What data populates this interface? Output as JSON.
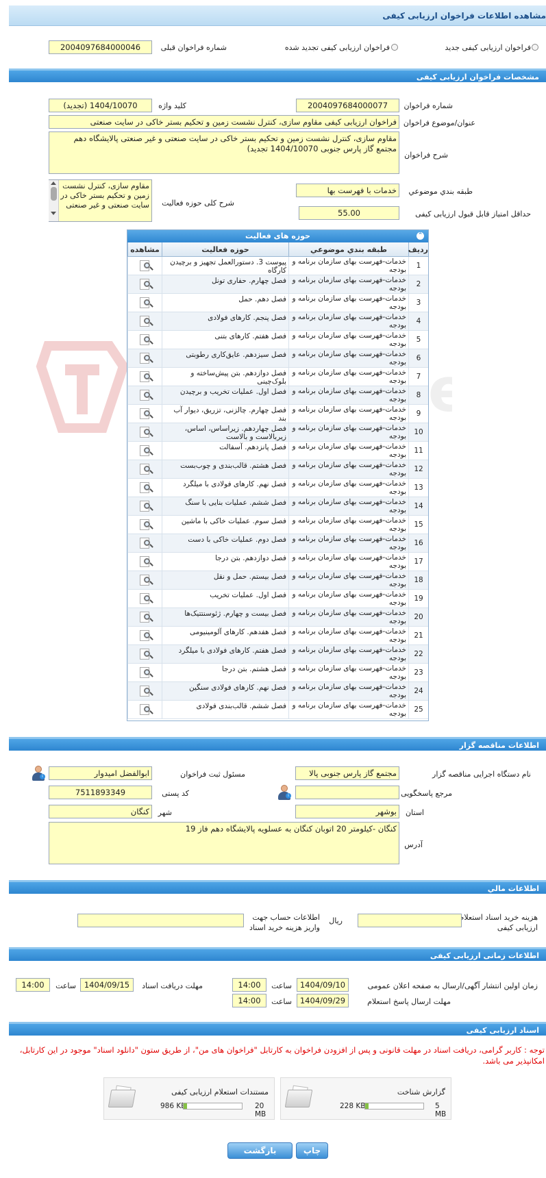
{
  "header": {
    "title": "مشاهده اطلاعات فراخوان ارزیابی کیفی"
  },
  "top": {
    "radio_new": "فراخوان ارزیابی کیفی جدید",
    "radio_renewed": "فراخوان ارزیابی کیفی تجدید شده",
    "prev_label": "شماره فراخوان قبلی",
    "prev_value": "2004097684000046"
  },
  "specs": {
    "section_title": "مشخصات فراخوان ارزیابی کیفی",
    "number_label": "شماره فراخوان",
    "number_value": "2004097684000077",
    "keyword_label": "کلید واژه",
    "keyword_value": "1404/10070 (تجدید)",
    "subject_label": "عنوان/موضوع فراخوان",
    "subject_value": "فراخوان ارزیابی کیفی مقاوم سازی، کنترل نشست زمین و تحکیم بستر خاکی در سایت صنعتی",
    "desc_label": "شرح فراخوان",
    "desc_value": "مقاوم سازی، کنترل نشست زمین و تحکیم بستر خاکی در سایت صنعتی و غیر صنعتی پالایشگاه دهم مجتمع گاز پارس جنوبی 1404/10070 تجدید)",
    "category_label": "طبقه بندي موضوعي",
    "category_value": "خدمات با فهرست بها",
    "scope_label": "شرح کلی حوزه فعالیت",
    "scope_value": "مقاوم سازی، کنترل نشست زمین و تحکیم بستر خاکی در سایت صنعتی و غیر صنعتی",
    "minscore_label": "حداقل امتیاز قابل قبول ارزیابی کیفی",
    "minscore_value": "55.00"
  },
  "activity": {
    "title": "حوزه های فعالیت",
    "headers": {
      "row": "رديف",
      "category": "طبقه بندي موضوعي",
      "field": "حوزه فعالیت",
      "view": "مشاهده"
    },
    "rows": [
      {
        "n": "1",
        "cat": "خدمات-فهرست بهای سازمان برنامه و بودجه",
        "field": "پیوست 3. دستورالعمل تجهیز و برچیدن کارگاه"
      },
      {
        "n": "2",
        "cat": "خدمات-فهرست بهای سازمان برنامه و بودجه",
        "field": "فصل چهارم. حفاری تونل"
      },
      {
        "n": "3",
        "cat": "خدمات-فهرست بهای سازمان برنامه و بودجه",
        "field": "فصل دهم. حمل"
      },
      {
        "n": "4",
        "cat": "خدمات-فهرست بهای سازمان برنامه و بودجه",
        "field": "فصل پنجم. کارهای فولادی"
      },
      {
        "n": "5",
        "cat": "خدمات-فهرست بهای سازمان برنامه و بودجه",
        "field": "فصل هفتم. کارهای بتنی"
      },
      {
        "n": "6",
        "cat": "خدمات-فهرست بهای سازمان برنامه و بودجه",
        "field": "فصل سیزدهم. عایق‌کاری رطوبتی"
      },
      {
        "n": "7",
        "cat": "خدمات-فهرست بهای سازمان برنامه و بودجه",
        "field": "فصل دوازدهم. بتن پیش‌ساخته و بلوک‌چینی"
      },
      {
        "n": "8",
        "cat": "خدمات-فهرست بهای سازمان برنامه و بودجه",
        "field": "فصل اول. عملیات تخریب و برچیدن"
      },
      {
        "n": "9",
        "cat": "خدمات-فهرست بهای سازمان برنامه و بودجه",
        "field": "فصل چهارم. چالزنی، تزریق، دیوار آب بند"
      },
      {
        "n": "10",
        "cat": "خدمات-فهرست بهای سازمان برنامه و بودجه",
        "field": "فصل چهاردهم. زیراساس، اساس، زیربالاست و بالاست"
      },
      {
        "n": "11",
        "cat": "خدمات-فهرست بهای سازمان برنامه و بودجه",
        "field": "فصل پانزدهم. آسفالت"
      },
      {
        "n": "12",
        "cat": "خدمات-فهرست بهای سازمان برنامه و بودجه",
        "field": "فصل هشتم. قالب‌بندی و چوب‌بست"
      },
      {
        "n": "13",
        "cat": "خدمات-فهرست بهای سازمان برنامه و بودجه",
        "field": "فصل نهم. کارهای فولادی با میلگرد"
      },
      {
        "n": "14",
        "cat": "خدمات-فهرست بهای سازمان برنامه و بودجه",
        "field": "فصل ششم. عملیات بنایی با سنگ"
      },
      {
        "n": "15",
        "cat": "خدمات-فهرست بهای سازمان برنامه و بودجه",
        "field": "فصل سوم. عملیات خاکی با ماشین"
      },
      {
        "n": "16",
        "cat": "خدمات-فهرست بهای سازمان برنامه و بودجه",
        "field": "فصل دوم. عملیات خاکی با دست"
      },
      {
        "n": "17",
        "cat": "خدمات-فهرست بهای سازمان برنامه و بودجه",
        "field": "فصل دوازدهم. بتن درجا"
      },
      {
        "n": "18",
        "cat": "خدمات-فهرست بهای سازمان برنامه و بودجه",
        "field": "فصل بیستم. حمل و نقل"
      },
      {
        "n": "19",
        "cat": "خدمات-فهرست بهای سازمان برنامه و بودجه",
        "field": "فصل اول. عملیات تخریب"
      },
      {
        "n": "20",
        "cat": "خدمات-فهرست بهای سازمان برنامه و بودجه",
        "field": "فصل بیست و چهارم. ژئوسنتتیک‌ها"
      },
      {
        "n": "21",
        "cat": "خدمات-فهرست بهای سازمان برنامه و بودجه",
        "field": "فصل هفدهم. کارهای آلومینیومی"
      },
      {
        "n": "22",
        "cat": "خدمات-فهرست بهای سازمان برنامه و بودجه",
        "field": "فصل هفتم. کارهای فولادی با میلگرد"
      },
      {
        "n": "23",
        "cat": "خدمات-فهرست بهای سازمان برنامه و بودجه",
        "field": "فصل هشتم. بتن درجا"
      },
      {
        "n": "24",
        "cat": "خدمات-فهرست بهای سازمان برنامه و بودجه",
        "field": "فصل نهم. کارهای فولادی سنگین"
      },
      {
        "n": "25",
        "cat": "خدمات-فهرست بهای سازمان برنامه و بودجه",
        "field": "فصل ششم. قالب‌بندی فولادی"
      }
    ]
  },
  "tenderer": {
    "section_title": "اطلاعات مناقصه گزار",
    "org_label": "نام دستگاه اجرایی مناقصه گزار",
    "org_value": "مجتمع گاز پارس جنوبی  پالا",
    "reg_label": "مسئول ثبت فراخوان",
    "reg_value": "ابوالفضل امیدوار",
    "ref_label": "مرجع پاسخگویی",
    "ref_value": "",
    "postal_label": "کد پستی",
    "postal_value": "7511893349",
    "province_label": "استان",
    "province_value": "بوشهر",
    "city_label": "شهر",
    "city_value": "کنگان",
    "address_label": "آدرس",
    "address_value": "کنگان -کیلومتر 20 اتوبان کنگان به عسلویه پالایشگاه دهم فاز 19"
  },
  "finance": {
    "section_title": "اطلاعات مالي",
    "fee_label": "هزینه خرید اسناد استعلام ارزیابی کیفی",
    "fee_unit": "ریال",
    "fee_value": "",
    "account_label": "اطلاعات حساب جهت واریز هزینه خرید اسناد",
    "account_value": ""
  },
  "timing": {
    "section_title": "اطلاعات زمانی ارزیابی کیفی",
    "publish_label": "زمان اولین انتشار آگهی/ارسال به صفحه اعلان عمومی",
    "publish_date": "1404/09/10",
    "publish_time": "14:00",
    "receive_label": "مهلت دریافت اسناد",
    "receive_date": "1404/09/15",
    "receive_time": "14:00",
    "reply_label": "مهلت ارسال پاسخ استعلام",
    "reply_date": "1404/09/29",
    "reply_time": "14:00",
    "time_label": "ساعت"
  },
  "docs": {
    "section_title": "اسناد ارزیابی کیفی",
    "note": "توجه : کاربر گرامی، دریافت اسناد در مهلت قانونی و پس از افزودن فراخوان به کارتابل \"فراخوان های من\"، از طریق ستون \"دانلود اسناد\" موجود در این کارتابل، امکانپذیر می باشد.",
    "files": [
      {
        "name": "گزارش شناخت",
        "size": "228 KB",
        "max": "5 MB",
        "fill": 0.05
      },
      {
        "name": "مستندات استعلام ارزیابی کیفی",
        "size": "986 KB",
        "max": "20 MB",
        "fill": 0.05
      }
    ]
  },
  "buttons": {
    "print": "چاپ",
    "back": "بازگشت"
  },
  "watermark": "AriaTender.net"
}
